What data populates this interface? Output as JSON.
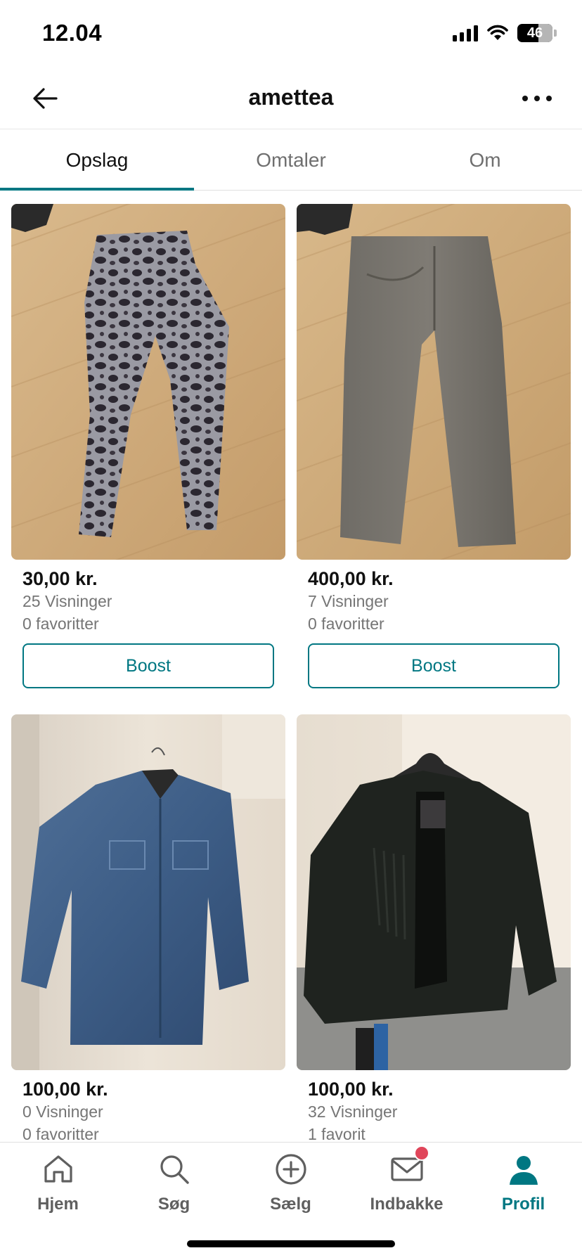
{
  "status_bar": {
    "time": "12.04",
    "battery": "46"
  },
  "header": {
    "title": "amettea"
  },
  "tabs": [
    {
      "label": "Opslag",
      "active": true
    },
    {
      "label": "Omtaler",
      "active": false
    },
    {
      "label": "Om",
      "active": false
    }
  ],
  "listings": [
    {
      "price": "30,00 kr.",
      "views": "25 Visninger",
      "favorites": "0 favoritter",
      "boost_label": "Boost"
    },
    {
      "price": "400,00 kr.",
      "views": "7 Visninger",
      "favorites": "0 favoritter",
      "boost_label": "Boost"
    },
    {
      "price": "100,00 kr.",
      "views": "0 Visninger",
      "favorites": "0 favoritter"
    },
    {
      "price": "100,00 kr.",
      "views": "32 Visninger",
      "favorites": "1 favorit"
    }
  ],
  "bottom_nav": [
    {
      "label": "Hjem",
      "icon": "home-icon"
    },
    {
      "label": "Søg",
      "icon": "search-icon"
    },
    {
      "label": "Sælg",
      "icon": "plus-circle-icon"
    },
    {
      "label": "Indbakke",
      "icon": "mail-icon",
      "has_badge": true
    },
    {
      "label": "Profil",
      "icon": "profile-icon",
      "active": true
    }
  ],
  "colors": {
    "accent": "#007782",
    "badge": "#e0455a",
    "muted_text": "#757575"
  }
}
